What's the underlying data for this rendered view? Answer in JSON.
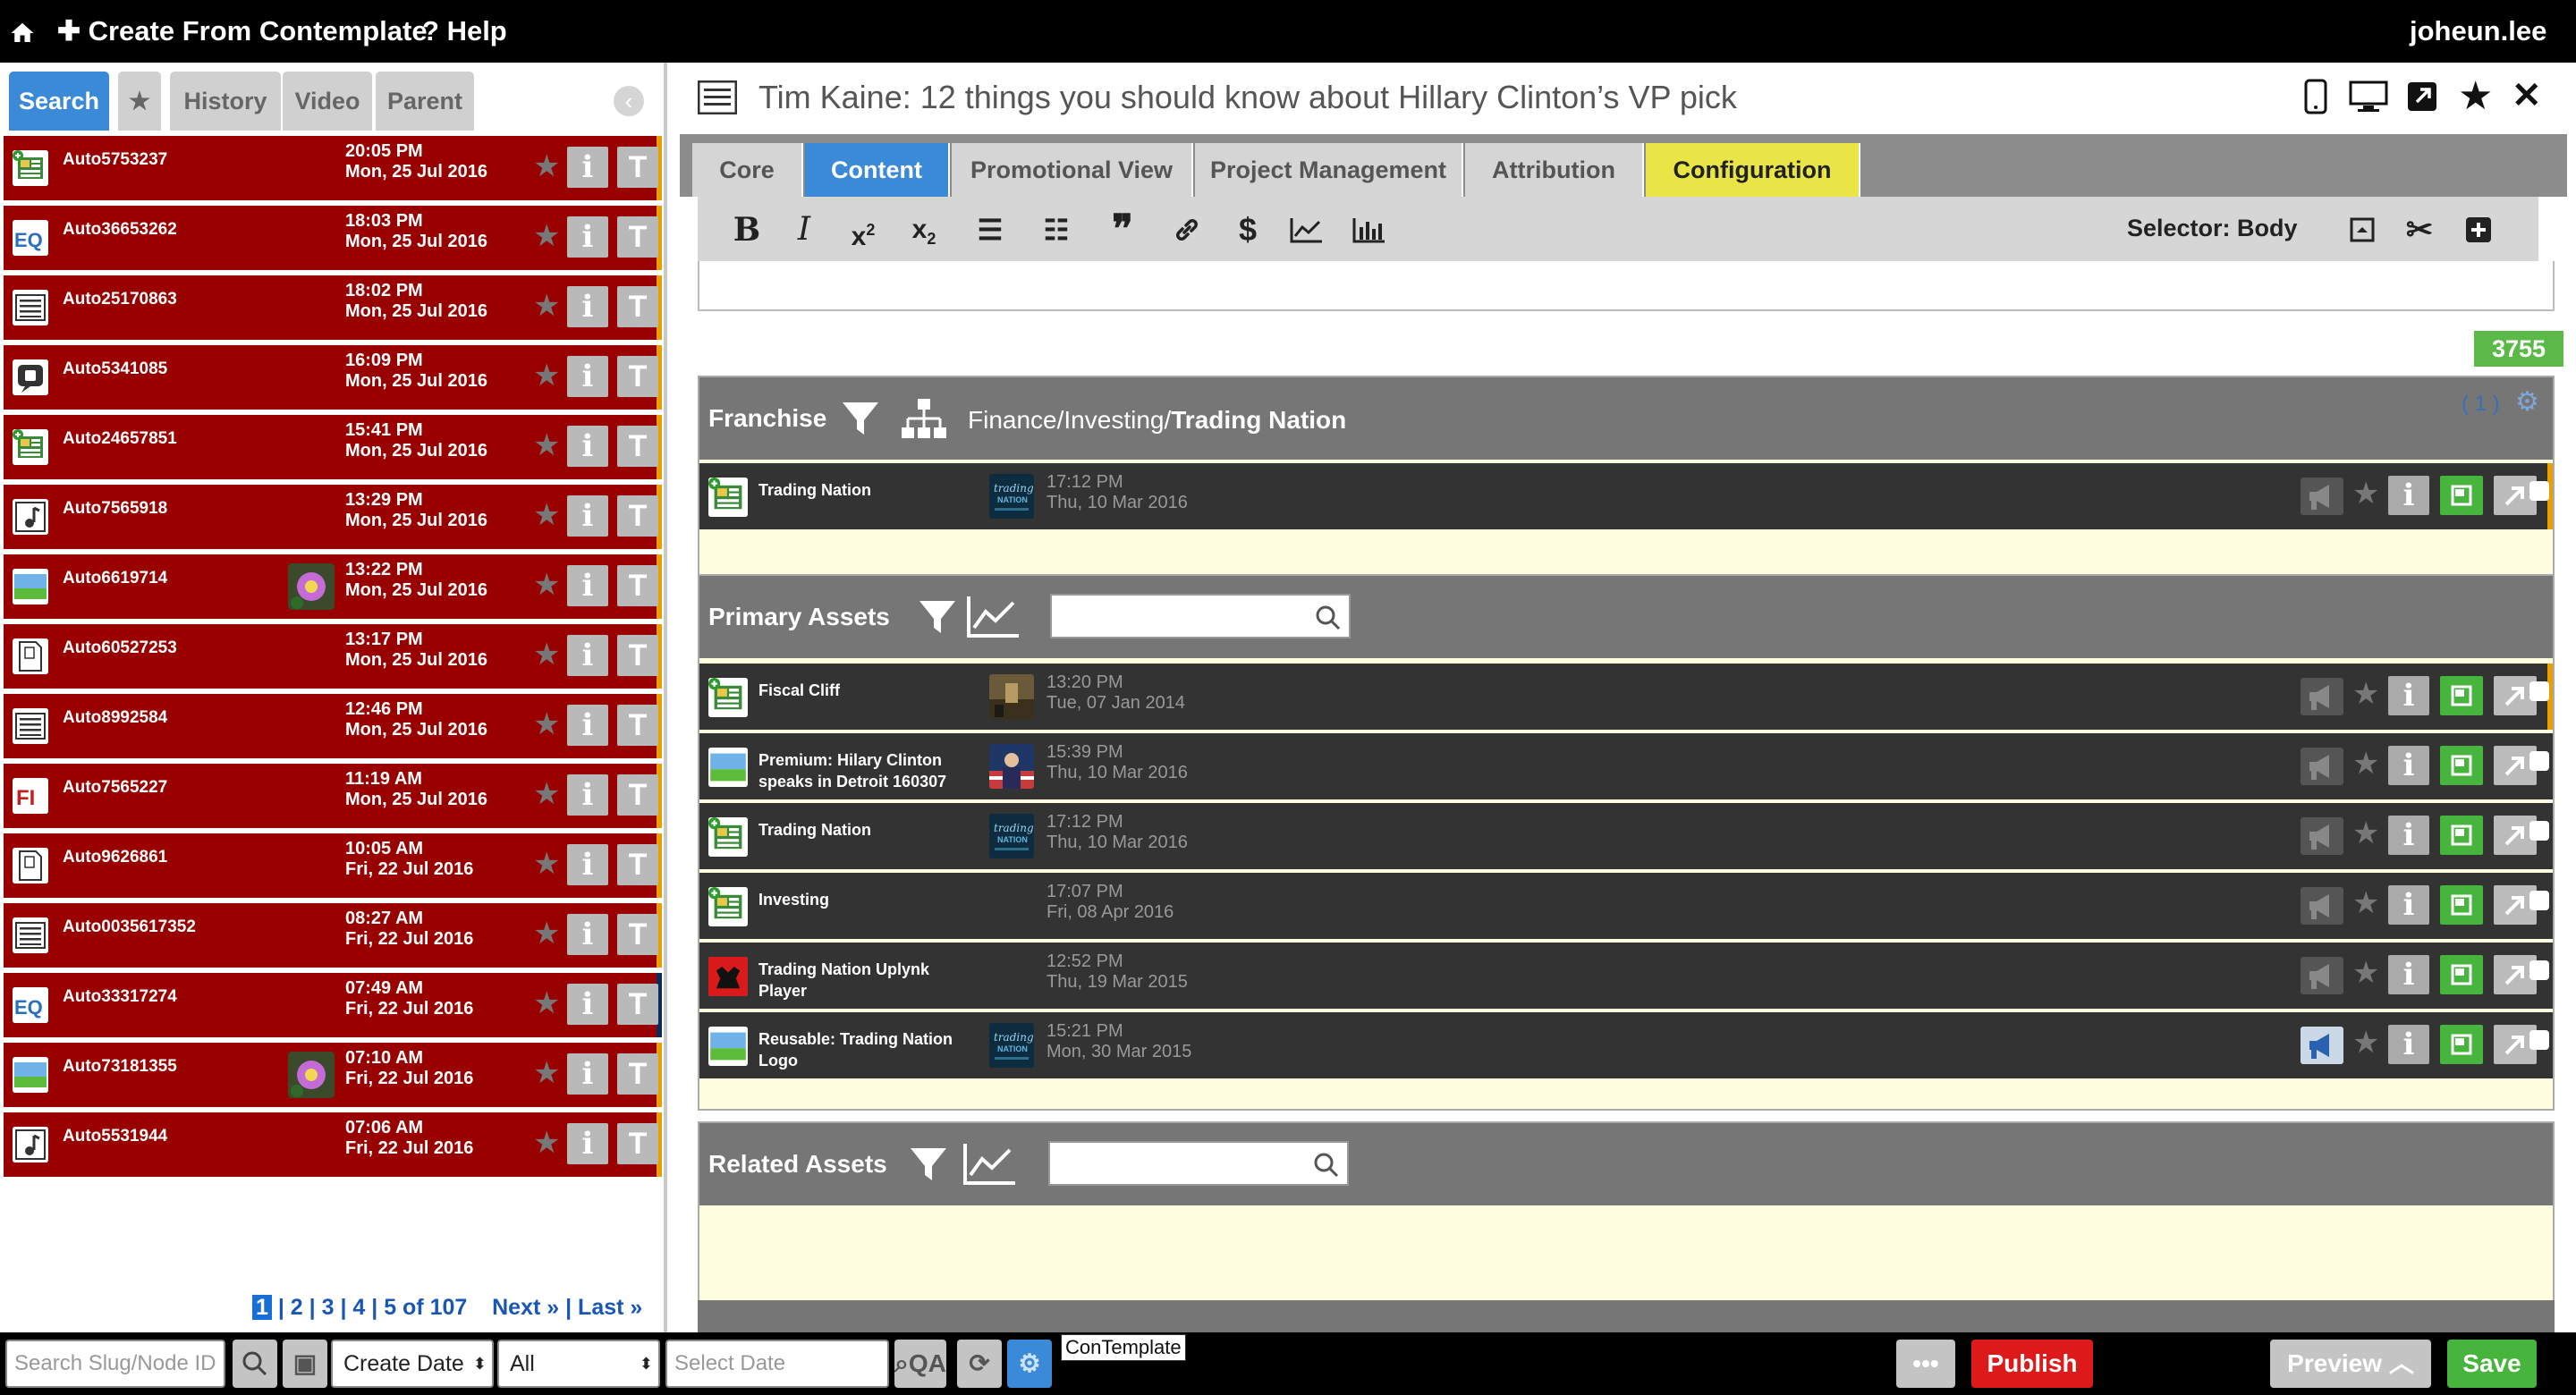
{
  "topbar": {
    "create_label": "Create From Contemplate",
    "help_label": "Help",
    "user": "joheun.lee"
  },
  "left": {
    "tabs": {
      "search": "Search",
      "history": "History",
      "video": "Video",
      "parent": "Parent"
    },
    "items": [
      {
        "slug": "Auto5753237",
        "time": "20:05 PM",
        "date": "Mon, 25 Jul 2016",
        "icon": "template-icon",
        "thumb": false
      },
      {
        "slug": "Auto36653262",
        "time": "18:03 PM",
        "date": "Mon, 25 Jul 2016",
        "icon": "eq-icon",
        "thumb": false
      },
      {
        "slug": "Auto25170863",
        "time": "18:02 PM",
        "date": "Mon, 25 Jul 2016",
        "icon": "article-icon",
        "thumb": false
      },
      {
        "slug": "Auto5341085",
        "time": "16:09 PM",
        "date": "Mon, 25 Jul 2016",
        "icon": "chat-icon",
        "thumb": false
      },
      {
        "slug": "Auto24657851",
        "time": "15:41 PM",
        "date": "Mon, 25 Jul 2016",
        "icon": "template-icon",
        "thumb": false
      },
      {
        "slug": "Auto7565918",
        "time": "13:29 PM",
        "date": "Mon, 25 Jul 2016",
        "icon": "music-icon",
        "thumb": false
      },
      {
        "slug": "Auto6619714",
        "time": "13:22 PM",
        "date": "Mon, 25 Jul 2016",
        "icon": "image-icon",
        "thumb": true
      },
      {
        "slug": "Auto60527253",
        "time": "13:17 PM",
        "date": "Mon, 25 Jul 2016",
        "icon": "document-icon",
        "thumb": false
      },
      {
        "slug": "Auto8992584",
        "time": "12:46 PM",
        "date": "Mon, 25 Jul 2016",
        "icon": "article-icon",
        "thumb": false
      },
      {
        "slug": "Auto7565227",
        "time": "11:19 AM",
        "date": "Mon, 25 Jul 2016",
        "icon": "fi-icon",
        "thumb": false
      },
      {
        "slug": "Auto9626861",
        "time": "10:05 AM",
        "date": "Fri, 22 Jul 2016",
        "icon": "document-icon",
        "thumb": false
      },
      {
        "slug": "Auto0035617352",
        "time": "08:27 AM",
        "date": "Fri, 22 Jul 2016",
        "icon": "article-icon",
        "thumb": false
      },
      {
        "slug": "Auto33317274",
        "time": "07:49 AM",
        "date": "Fri, 22 Jul 2016",
        "icon": "eq-icon",
        "thumb": false
      },
      {
        "slug": "Auto73181355",
        "time": "07:10 AM",
        "date": "Fri, 22 Jul 2016",
        "icon": "image-icon",
        "thumb": true
      },
      {
        "slug": "Auto5531944",
        "time": "07:06 AM",
        "date": "Fri, 22 Jul 2016",
        "icon": "music-icon",
        "thumb": false
      }
    ],
    "pagination": {
      "current": "1",
      "pages": [
        "2",
        "3",
        "4",
        "5"
      ],
      "of_text": "of 107",
      "next": "Next »",
      "last": "Last »"
    }
  },
  "right": {
    "title": "Tim Kaine: 12 things you should know about Hillary Clinton’s VP pick",
    "tabs": [
      "Core",
      "Content",
      "Promotional View",
      "Project Management",
      "Attribution",
      "Configuration"
    ],
    "selector": "Selector: Body",
    "word_count": "3755",
    "franchise": {
      "label": "Franchise",
      "path_prefix": "Finance/Investing/",
      "path_last": "Trading Nation",
      "count": "( 1 )",
      "items": [
        {
          "name": "Trading Nation",
          "time": "17:12 PM",
          "date": "Thu, 10 Mar 2016",
          "icon": "template-icon",
          "thumb": "tn",
          "broadcast_on": false
        }
      ]
    },
    "primary": {
      "label": "Primary Assets",
      "items": [
        {
          "name": "Fiscal Cliff",
          "time": "13:20 PM",
          "date": "Tue, 07 Jan 2014",
          "icon": "template-icon",
          "thumb": "photo",
          "broadcast_on": false
        },
        {
          "name": "Premium: Hilary Clinton speaks in Detroit 160307",
          "time": "15:39 PM",
          "date": "Thu, 10 Mar 2016",
          "icon": "image-icon",
          "thumb": "person",
          "broadcast_on": false
        },
        {
          "name": "Trading Nation",
          "time": "17:12 PM",
          "date": "Thu, 10 Mar 2016",
          "icon": "template-icon",
          "thumb": "tn",
          "broadcast_on": false
        },
        {
          "name": "Investing",
          "time": "17:07 PM",
          "date": "Fri, 08 Apr 2016",
          "icon": "template-icon",
          "thumb": "none",
          "broadcast_on": false
        },
        {
          "name": "Trading Nation Uplynk Player",
          "time": "12:52 PM",
          "date": "Thu, 19 Mar 2015",
          "icon": "player-icon",
          "thumb": "none",
          "broadcast_on": false
        },
        {
          "name": "Reusable: Trading Nation Logo",
          "time": "15:21 PM",
          "date": "Mon, 30 Mar 2015",
          "icon": "image-icon",
          "thumb": "tn",
          "broadcast_on": true
        }
      ]
    },
    "related": {
      "label": "Related Assets"
    }
  },
  "bottombar": {
    "search_placeholder": "Search Slug/Node ID",
    "sort_select": "Create Date",
    "filter_select": "All",
    "date_placeholder": "Select Date",
    "qa_label": "QA",
    "contemplate_tooltip": "ConTemplate",
    "more_label": "•••",
    "publish": "Publish",
    "preview": "Preview",
    "save": "Save"
  },
  "colors": {
    "accent_blue": "#3a8ad8",
    "item_red": "#990000",
    "publish_red": "#dd1a1a",
    "save_green": "#46b43d",
    "config_yellow": "#e9e547"
  }
}
